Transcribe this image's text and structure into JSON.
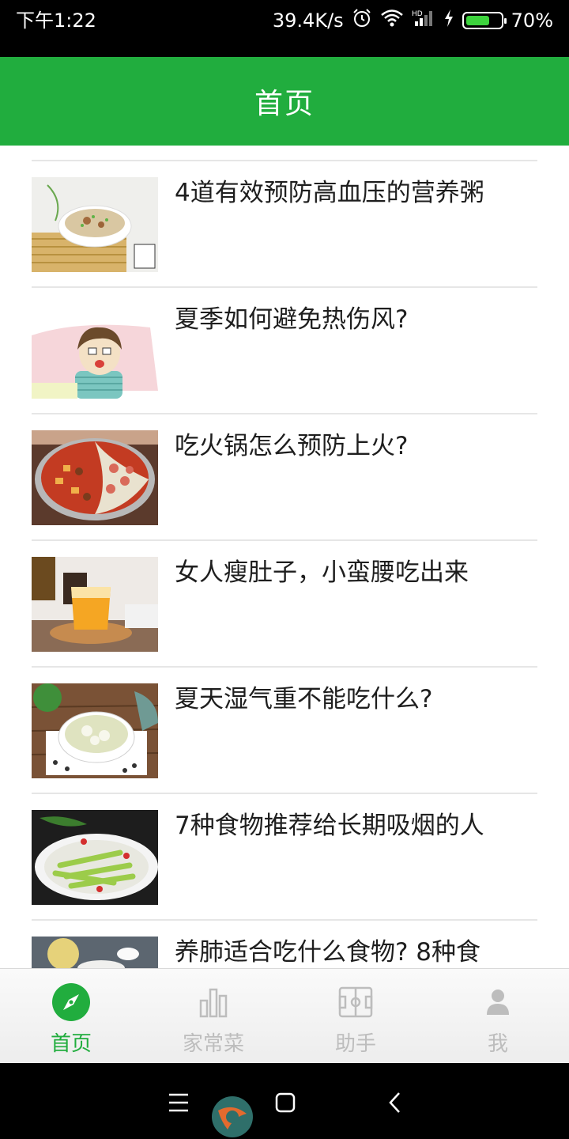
{
  "status_bar": {
    "time": "下午1:22",
    "network_speed": "39.4K/s",
    "battery_percent": "70%",
    "battery_level": 0.7,
    "icons": [
      "alarm-icon",
      "wifi-icon",
      "hd-signal-icon",
      "charging-icon",
      "battery-icon"
    ]
  },
  "header": {
    "title": "首页",
    "background_color": "#21ad3e"
  },
  "articles": [
    {
      "title": "4道有效预防高血压的营养粥",
      "thumbnail": "porridge-bowl"
    },
    {
      "title": "夏季如何避免热伤风?",
      "thumbnail": "cartoon-sick-person"
    },
    {
      "title": "吃火锅怎么预防上火?",
      "thumbnail": "hotpot"
    },
    {
      "title": "女人瘦肚子，小蛮腰吃出来",
      "thumbnail": "mango-drink"
    },
    {
      "title": "夏天湿气重不能吃什么?",
      "thumbnail": "soup-bowl"
    },
    {
      "title": "7种食物推荐给长期吸烟的人",
      "thumbnail": "stir-fried-vegetables"
    },
    {
      "title": "养肺适合吃什么食物? 8种食",
      "thumbnail": "pear-dessert"
    }
  ],
  "tab_bar": {
    "tabs": [
      {
        "label": "首页",
        "icon": "compass-icon",
        "active": true
      },
      {
        "label": "家常菜",
        "icon": "bar-chart-icon",
        "active": false
      },
      {
        "label": "助手",
        "icon": "field-icon",
        "active": false
      },
      {
        "label": "我",
        "icon": "person-icon",
        "active": false
      }
    ],
    "active_color": "#21ad3e",
    "inactive_color": "#bdbdbd"
  },
  "nav_bar": {
    "buttons": [
      "menu-icon",
      "home-square-icon",
      "back-icon"
    ]
  }
}
